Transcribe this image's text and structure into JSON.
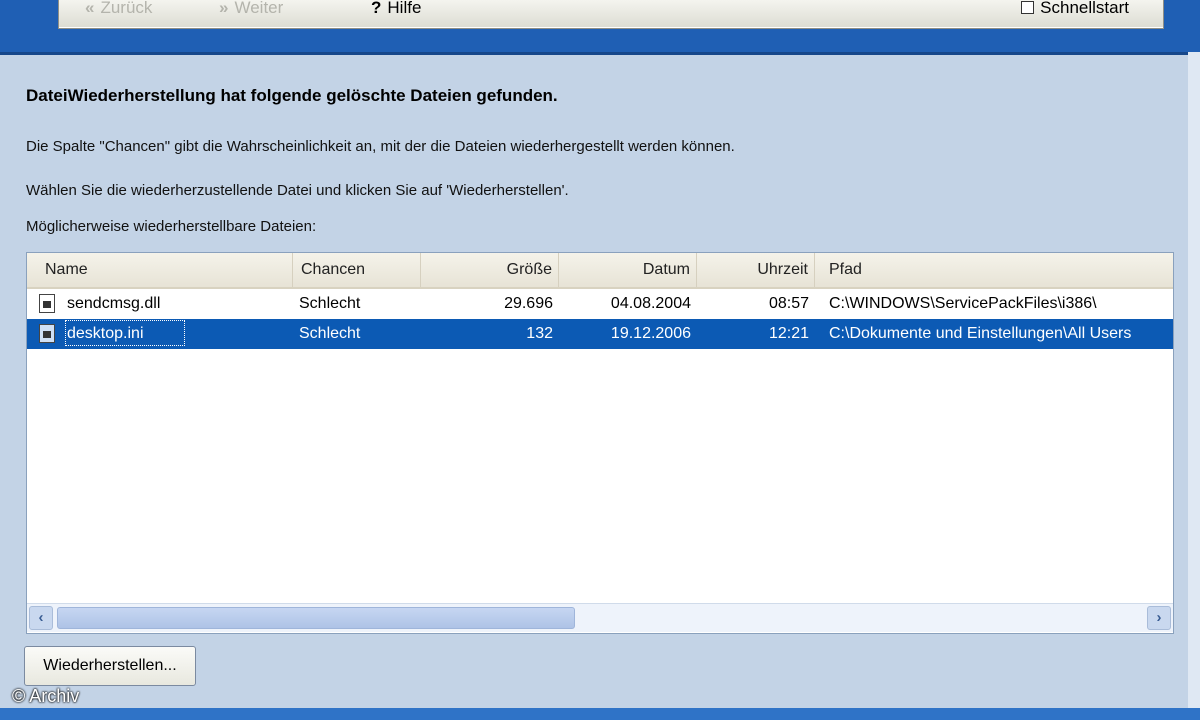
{
  "toolbar": {
    "back_label": "Zurück",
    "forward_label": "Weiter",
    "help_label": "Hilfe",
    "quickstart_label": "Schnellstart",
    "icons": {
      "back": "back-arrow-icon",
      "forward": "forward-arrow-icon",
      "help": "question-mark-icon",
      "quickstart": "checkbox-icon"
    }
  },
  "main": {
    "heading": "DateiWiederherstellung hat folgende gelöschte Dateien gefunden.",
    "info_line1": "Die Spalte \"Chancen\" gibt die Wahrscheinlichkeit an, mit der die Dateien wiederhergestellt werden können.",
    "info_line2": "Wählen Sie die wiederherzustellende Datei und klicken Sie auf 'Wiederherstellen'.",
    "list_label": "Möglicherweise wiederherstellbare Dateien:"
  },
  "table": {
    "columns": [
      "Name",
      "Chancen",
      "Größe",
      "Datum",
      "Uhrzeit",
      "Pfad"
    ],
    "rows": [
      {
        "name": "sendcmsg.dll",
        "chance": "Schlecht",
        "size": "29.696",
        "date": "04.08.2004",
        "time": "08:57",
        "path": "C:\\WINDOWS\\ServicePackFiles\\i386\\"
      },
      {
        "name": "desktop.ini",
        "chance": "Schlecht",
        "size": "132",
        "date": "19.12.2006",
        "time": "12:21",
        "path": "C:\\Dokumente und Einstellungen\\All Users"
      }
    ],
    "selected_row": 1
  },
  "actions": {
    "restore_label": "Wiederherstellen..."
  },
  "footer": {
    "copyright": "© Archiv"
  },
  "colors": {
    "selection": "#0c5ab4",
    "frame": "#1f5fb4",
    "background": "#c3d3e6"
  }
}
